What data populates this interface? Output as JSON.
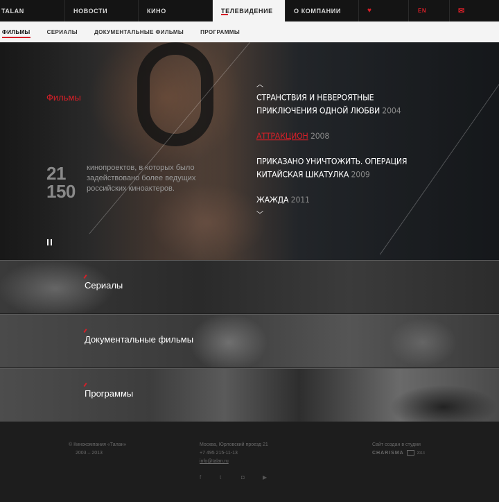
{
  "topnav": {
    "logo": "TALAN",
    "items": [
      "НОВОСТИ",
      "КИНО",
      "ТЕЛЕВИДЕНИЕ",
      "О КОМПАНИИ"
    ],
    "heart": "♥",
    "lang": "EN",
    "mail": "✉"
  },
  "subnav": {
    "items": [
      "ФИЛЬМЫ",
      "СЕРИАЛЫ",
      "ДОКУМЕНТАЛЬНЫЕ ФИЛЬМЫ",
      "ПРОГРАММЫ"
    ]
  },
  "hero": {
    "title": "Фильмы",
    "stat1": "21",
    "stat2": "150",
    "stats_text": "кинопроектов, в которых было задействовано более ведущих российских киноактеров.",
    "arrow_up": "︿",
    "arrow_down": "﹀",
    "films": [
      {
        "name": "СТРАНСТВИЯ И НЕВЕРОЯТНЫЕ ПРИКЛЮЧЕНИЯ ОДНОЙ ЛЮБВИ",
        "year": "2004"
      },
      {
        "name": "АТТРАКЦИОН",
        "year": "2008"
      },
      {
        "name": "ПРИКАЗАНО УНИЧТОЖИТЬ. ОПЕРАЦИЯ КИТАЙСКАЯ ШКАТУЛКА",
        "year": "2009"
      },
      {
        "name": "ЖАЖДА",
        "year": "2011"
      }
    ]
  },
  "bands": [
    "Сериалы",
    "Документальные фильмы",
    "Программы"
  ],
  "footer": {
    "copyright": "© Кинокомпания «Талан»",
    "years": "2003 – 2013",
    "address": "Москва, Юрловский проезд 21",
    "phone": "+7 495 215-11-13",
    "email": "info@talan.ru",
    "studio_text": "Сайт создан в студии",
    "studio_name": "CHARISMA",
    "studio_year": "2013"
  },
  "colors": {
    "accent": "#d71f28",
    "dark": "#141414",
    "light": "#f4f4f4"
  }
}
